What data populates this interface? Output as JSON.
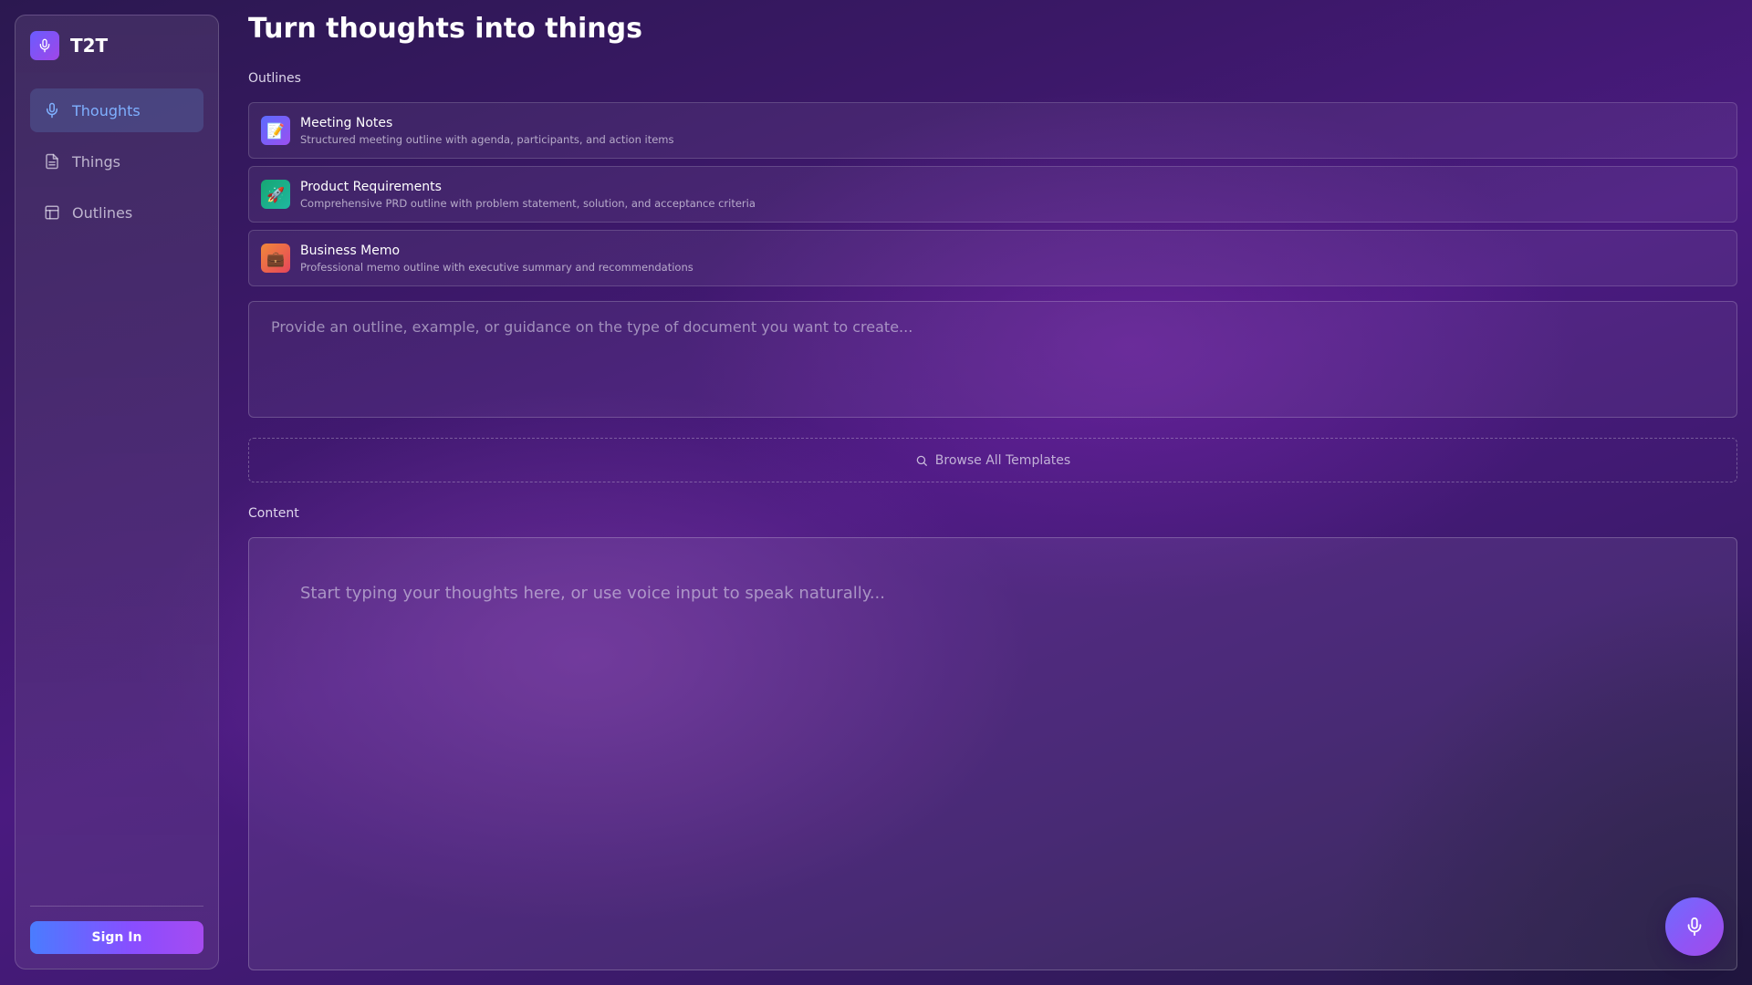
{
  "app": {
    "name": "T2T"
  },
  "sidebar": {
    "items": [
      {
        "label": "Thoughts",
        "icon": "mic-icon",
        "active": true
      },
      {
        "label": "Things",
        "icon": "document-icon",
        "active": false
      },
      {
        "label": "Outlines",
        "icon": "layout-icon",
        "active": false
      }
    ],
    "sign_in_label": "Sign In"
  },
  "main": {
    "title": "Turn thoughts into things",
    "outlines_label": "Outlines",
    "templates": [
      {
        "title": "Meeting Notes",
        "description": "Structured meeting outline with agenda, participants, and action items",
        "icon": "memo-icon",
        "icon_glyph": "📝",
        "color_from": "#5b6cff",
        "color_to": "#9b4ff0"
      },
      {
        "title": "Product Requirements",
        "description": "Comprehensive PRD outline with problem statement, solution, and acceptance criteria",
        "icon": "rocket-icon",
        "icon_glyph": "🚀",
        "color_from": "#17a673",
        "color_to": "#1fb8a0"
      },
      {
        "title": "Business Memo",
        "description": "Professional memo outline with executive summary and recommendations",
        "icon": "briefcase-icon",
        "icon_glyph": "💼",
        "color_from": "#f0883a",
        "color_to": "#e6455a"
      }
    ],
    "guidance_placeholder": "Provide an outline, example, or guidance on the type of document you want to create...",
    "browse_label": "Browse All Templates",
    "content_label": "Content",
    "content_placeholder": "Start typing your thoughts here, or use voice input to speak naturally..."
  },
  "colors": {
    "accent": "#7fb0ff",
    "brand_gradient_from": "#6a5cff",
    "brand_gradient_to": "#a046e8"
  }
}
